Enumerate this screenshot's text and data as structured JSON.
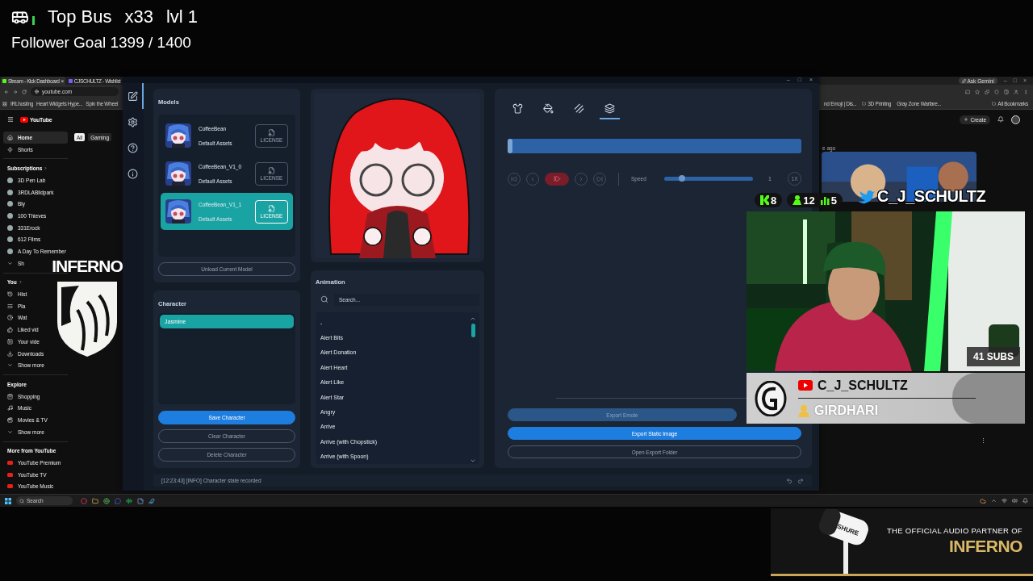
{
  "stream_overlay": {
    "top_bus": {
      "label": "Top Bus",
      "count": "x33",
      "level": "lvl 1"
    },
    "follower_goal": "Follower Goal 1399 / 1400"
  },
  "browser_left": {
    "tabs": [
      {
        "title": "Stream - Kick Dashboard",
        "close": "×",
        "selected": true
      },
      {
        "title": "CJSCHULTZ - Wishlist",
        "selected": false
      }
    ],
    "address": "youtube.com",
    "bookmarks": [
      "IRLhosting",
      "Heart Widgets Hype...",
      "Spin the Wheel"
    ],
    "logo_text": "YouTube",
    "chips": [
      {
        "label": "All",
        "selected": true
      },
      {
        "label": "Gaming",
        "selected": false
      }
    ],
    "sidebar": [
      {
        "kind": "item",
        "label": "Home",
        "selected": true
      },
      {
        "kind": "item",
        "label": "Shorts",
        "selected": false
      },
      {
        "kind": "divider"
      },
      {
        "kind": "heading",
        "label": "Subscriptions",
        "arrow": true
      },
      {
        "kind": "channel",
        "label": "3D Pen Lab",
        "selected": false
      },
      {
        "kind": "channel",
        "label": "3RDLABlidpark",
        "selected": false
      },
      {
        "kind": "channel",
        "label": "Bly",
        "selected": false
      },
      {
        "kind": "channel",
        "label": "100 Thieves",
        "selected": false
      },
      {
        "kind": "channel",
        "label": "331Erock",
        "selected": false
      },
      {
        "kind": "channel",
        "label": "612 Films",
        "selected": false
      },
      {
        "kind": "channel",
        "label": "A Day To Remember",
        "selected": false
      },
      {
        "kind": "item",
        "label": "Sh",
        "selected": false
      },
      {
        "kind": "divider"
      },
      {
        "kind": "heading",
        "label": "You",
        "arrow": true
      },
      {
        "kind": "item",
        "label": "Hist",
        "selected": false
      },
      {
        "kind": "item",
        "label": "Pla",
        "selected": false
      },
      {
        "kind": "item",
        "label": "Wat",
        "selected": false
      },
      {
        "kind": "item",
        "label": "Liked vid",
        "selected": false
      },
      {
        "kind": "item",
        "label": "Your vide",
        "selected": false
      },
      {
        "kind": "item",
        "label": "Downloads",
        "selected": false
      },
      {
        "kind": "item",
        "label": "Show more",
        "selected": false
      },
      {
        "kind": "divider"
      },
      {
        "kind": "heading",
        "label": "Explore",
        "arrow": false
      },
      {
        "kind": "item",
        "label": "Shopping",
        "selected": false
      },
      {
        "kind": "item",
        "label": "Music",
        "selected": false
      },
      {
        "kind": "item",
        "label": "Movies & TV",
        "selected": false
      },
      {
        "kind": "item",
        "label": "Show more",
        "selected": false
      },
      {
        "kind": "divider"
      },
      {
        "kind": "heading",
        "label": "More from YouTube",
        "arrow": false
      },
      {
        "kind": "item",
        "label": "YouTube Premium",
        "selected": false
      },
      {
        "kind": "item",
        "label": "YouTube TV",
        "selected": false
      },
      {
        "kind": "item",
        "label": "YouTube Music",
        "selected": false
      }
    ]
  },
  "browser_right": {
    "assistant": "Ask Gemini",
    "window_controls": [
      "–",
      "□",
      "×"
    ],
    "bookmarks": [
      {
        "label": "nd Emoji | Dis...",
        "kind": "link"
      },
      {
        "label": "3D Printing",
        "kind": "folder"
      },
      {
        "label": "Gray Zone Warfare...",
        "kind": "link"
      },
      {
        "label": "All Bookmarks",
        "kind": "folder"
      }
    ],
    "create": "Create",
    "video_age": "e ago",
    "more": "⋮"
  },
  "app": {
    "window_controls": [
      "–",
      "□",
      "×"
    ],
    "rail": [
      {
        "selected": true
      },
      {
        "selected": false
      },
      {
        "selected": false
      },
      {
        "selected": false
      }
    ],
    "models": {
      "title": "Models",
      "items": [
        {
          "name": "CoffeeBean",
          "source": "Default Assets",
          "license": "LICENSE",
          "selected": false
        },
        {
          "name": "CoffeeBean_V1_0",
          "source": "Default Assets",
          "license": "LICENSE",
          "selected": false
        },
        {
          "name": "CoffeeBean_V1_1",
          "source": "Default Assets",
          "license": "LICENSE",
          "selected": true
        }
      ],
      "unload": "Unload Current Model"
    },
    "character": {
      "title": "Character",
      "items": [
        {
          "name": "Jasmine",
          "selected": true
        }
      ],
      "buttons": [
        {
          "label": "Save Character",
          "kind": "primary"
        },
        {
          "label": "Clear Character",
          "kind": "outline"
        },
        {
          "label": "Delete Character",
          "kind": "outline"
        }
      ]
    },
    "animation": {
      "title": "Animation",
      "search": {
        "placeholder": "Search..."
      },
      "items": [
        "-",
        "Alert Bits",
        "Alert Donation",
        "Alert Heart",
        "Alert Like",
        "Alert Star",
        "Angry",
        "Arrive",
        "Arrive (with Chopstick)",
        "Arrive (with Spoon)"
      ]
    },
    "export": {
      "tabs": [
        {
          "selected": false
        },
        {
          "selected": false
        },
        {
          "selected": false
        },
        {
          "selected": true
        }
      ],
      "timeline": {
        "level": 0
      },
      "controls": [
        {
          "kind": "first"
        },
        {
          "kind": "prev"
        },
        {
          "kind": "play"
        },
        {
          "kind": "next"
        },
        {
          "kind": "last"
        }
      ],
      "speed": {
        "label": "Speed",
        "level": 0.18,
        "value": "1",
        "reset": "1X"
      },
      "buttons": [
        {
          "label": "Export Emote",
          "kind": "muted"
        },
        {
          "label": "Export Static Image",
          "kind": "primary"
        },
        {
          "label": "Open Export Folder",
          "kind": "outline"
        }
      ]
    },
    "status": "[12:23:43] [INFO] Character state recorded"
  },
  "overlay": {
    "logo": "INFERNO",
    "stats": [
      {
        "items": [
          {
            "kind": "kick",
            "value": "8"
          }
        ]
      },
      {
        "items": [
          {
            "kind": "followers",
            "value": "12"
          },
          {
            "kind": "viewers",
            "value": "5"
          }
        ]
      }
    ],
    "channel_name": "C_J_SCHULTZ",
    "subs": "41 SUBS",
    "name_bar": {
      "channel": "C_J_SCHULTZ",
      "viewer": "GIRDHARI"
    }
  },
  "sponsor": {
    "mic_label": "SHURE",
    "tagline": "THE OFFICIAL AUDIO PARTNER OF",
    "brand": "INFERNO"
  },
  "taskbar": {
    "search": {
      "placeholder": "Search"
    }
  }
}
